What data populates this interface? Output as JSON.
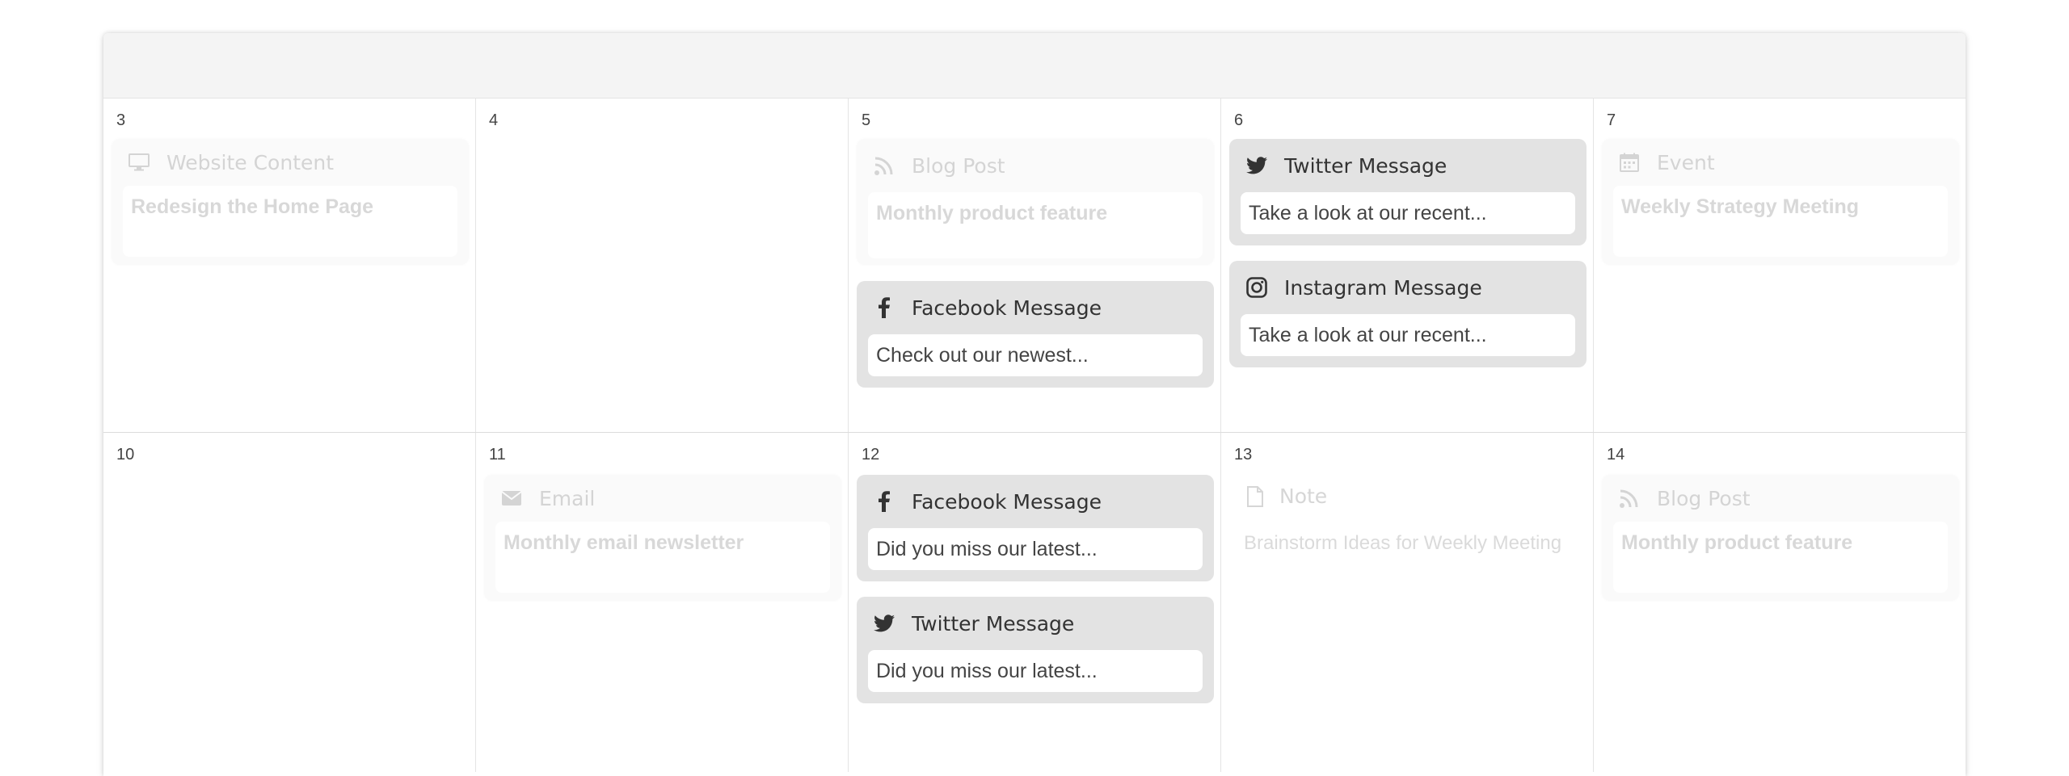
{
  "colors": {
    "active_card_bg": "#e3e3e3",
    "faded_card_bg": "#fafafa",
    "header_bg": "#f4f4f4",
    "text_dark": "#333333",
    "text_faded": "#d4d4d4"
  },
  "week1": {
    "days": [
      {
        "num": "3"
      },
      {
        "num": "4"
      },
      {
        "num": "5"
      },
      {
        "num": "6"
      },
      {
        "num": "7"
      }
    ],
    "website_content": {
      "type": "Website Content",
      "icon": "monitor-icon",
      "title": "Redesign the Home Page"
    },
    "blog_post": {
      "type": "Blog Post",
      "icon": "rss-icon",
      "title": "Monthly product feature"
    },
    "facebook": {
      "type": "Facebook Message",
      "icon": "facebook-icon",
      "text": "Check out our newest..."
    },
    "twitter": {
      "type": "Twitter Message",
      "icon": "twitter-icon",
      "text": "Take a look at our recent..."
    },
    "instagram": {
      "type": "Instagram Message",
      "icon": "instagram-icon",
      "text": "Take a look at our recent..."
    },
    "event": {
      "type": "Event",
      "icon": "calendar-icon",
      "title": "Weekly Strategy Meeting"
    }
  },
  "week2": {
    "days": [
      {
        "num": "10"
      },
      {
        "num": "11"
      },
      {
        "num": "12"
      },
      {
        "num": "13"
      },
      {
        "num": "14"
      }
    ],
    "email": {
      "type": "Email",
      "icon": "envelope-icon",
      "title": "Monthly email newsletter"
    },
    "facebook": {
      "type": "Facebook Message",
      "icon": "facebook-icon",
      "text": "Did you miss our latest..."
    },
    "twitter": {
      "type": "Twitter Message",
      "icon": "twitter-icon",
      "text": "Did you miss our latest..."
    },
    "note": {
      "type": "Note",
      "icon": "document-icon",
      "text": "Brainstorm Ideas for Weekly Meeting"
    },
    "blog_post": {
      "type": "Blog Post",
      "icon": "rss-icon",
      "title": "Monthly product feature"
    }
  }
}
